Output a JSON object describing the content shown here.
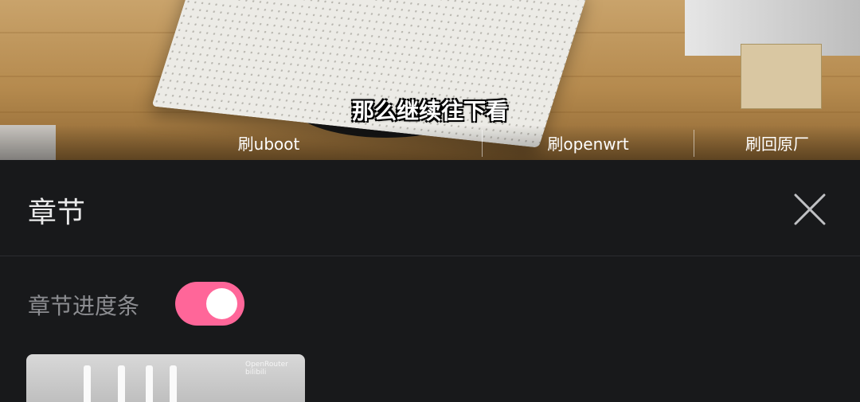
{
  "video": {
    "subtitle": "那么继续往下看",
    "chapters": [
      "刷uboot",
      "刷openwrt",
      "刷回原厂"
    ]
  },
  "panel": {
    "title": "章节",
    "close_icon": "close-icon",
    "toggle_label": "章节进度条",
    "toggle_on": true,
    "accent_color": "#ff6699",
    "thumbnail_mark": "OpenRouter bilibili"
  }
}
